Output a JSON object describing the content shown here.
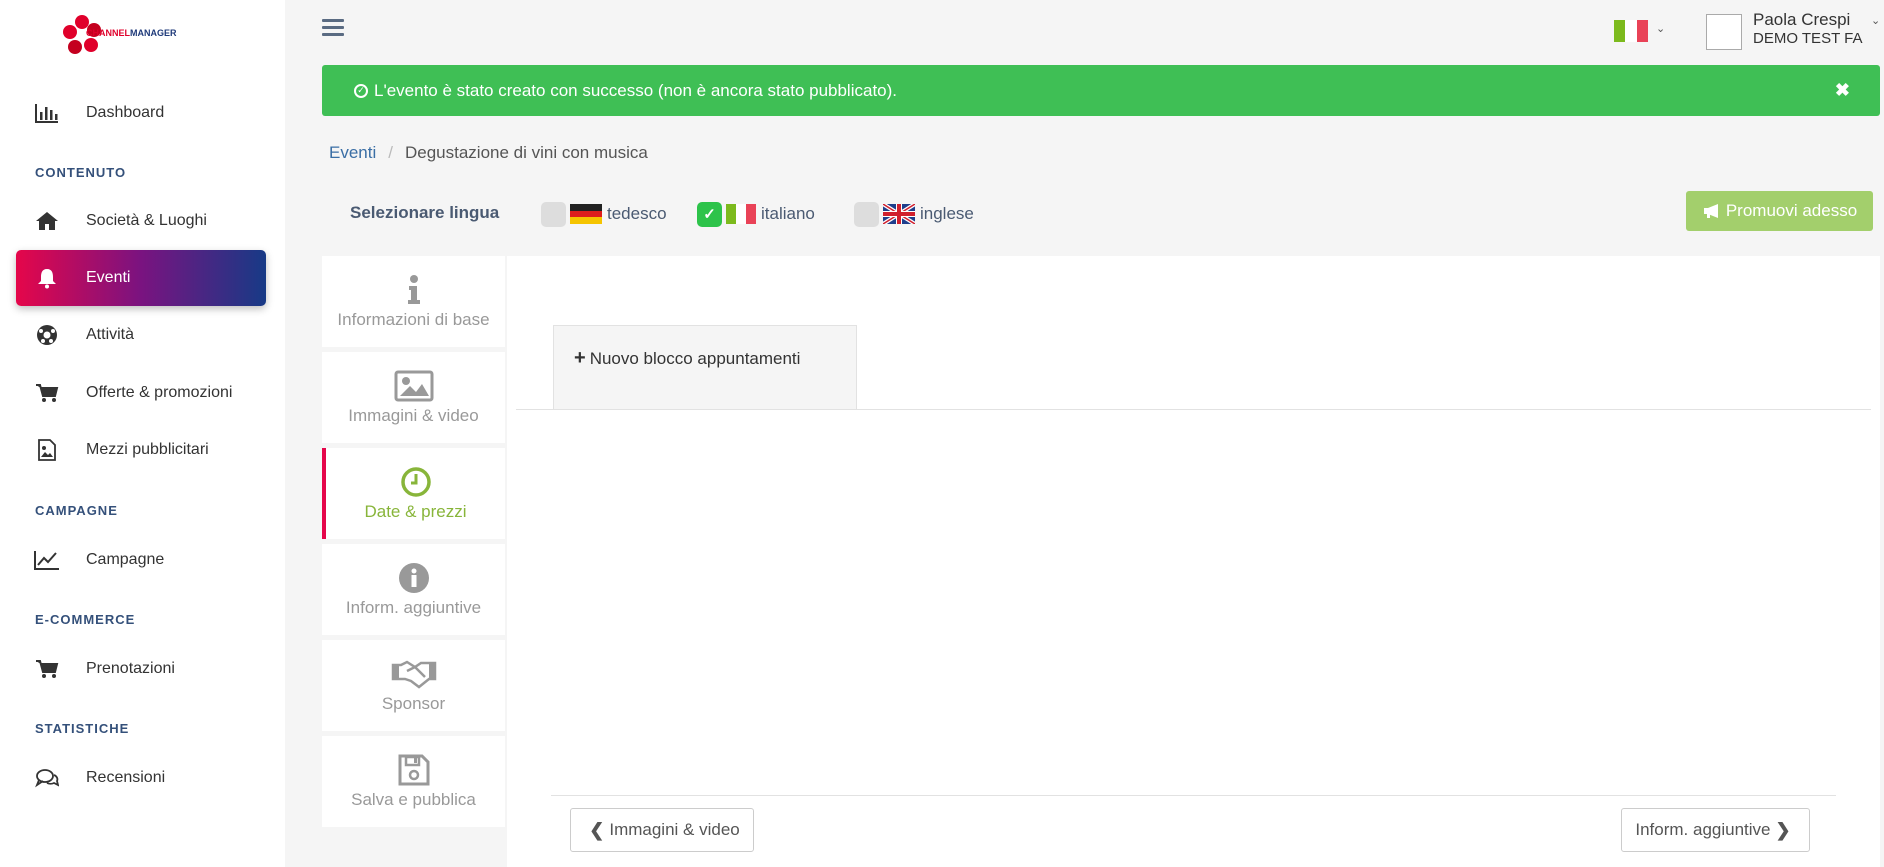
{
  "app": {
    "logo_text_part1": "CHANNEL",
    "logo_text_part2": "MANAGER"
  },
  "sidebar": {
    "items": [
      {
        "label": "Dashboard",
        "icon": "bar-chart-icon"
      },
      {
        "label": "Società & Luoghi",
        "icon": "home-icon"
      },
      {
        "label": "Eventi",
        "icon": "bell-icon"
      },
      {
        "label": "Attività",
        "icon": "soccer-ball-icon"
      },
      {
        "label": "Offerte & promozioni",
        "icon": "cart-icon"
      },
      {
        "label": "Mezzi pubblicitari",
        "icon": "image-file-icon"
      },
      {
        "label": "Campagne",
        "icon": "line-chart-icon"
      },
      {
        "label": "Prenotazioni",
        "icon": "cart-icon"
      },
      {
        "label": "Recensioni",
        "icon": "comments-icon"
      }
    ],
    "sections": {
      "contenuto": "CONTENUTO",
      "campagne": "CAMPAGNE",
      "ecommerce": "E-COMMERCE",
      "statistiche": "STATISTICHE"
    },
    "active_item": "Eventi"
  },
  "header": {
    "user_name": "Paola Crespi",
    "user_org": "DEMO TEST FA"
  },
  "alert": {
    "message": "L'evento è stato creato con successo (non è ancora stato pubblicato).",
    "color": "#3fbf55"
  },
  "breadcrumb": {
    "parent": "Eventi",
    "separator": "/",
    "current": "Degustazione di vini con musica"
  },
  "language": {
    "label": "Selezionare lingua",
    "options": [
      {
        "label": "tedesco",
        "checked": false
      },
      {
        "label": "italiano",
        "checked": true
      },
      {
        "label": "inglese",
        "checked": false
      }
    ]
  },
  "promote_button": "Promuovi adesso",
  "steps": [
    {
      "label": "Informazioni di base",
      "icon": "info-icon",
      "active": false
    },
    {
      "label": "Immagini & video",
      "icon": "picture-icon",
      "active": false
    },
    {
      "label": "Date & prezzi",
      "icon": "clock-icon",
      "active": true
    },
    {
      "label": "Inform. aggiuntive",
      "icon": "info-circle-icon",
      "active": false
    },
    {
      "label": "Sponsor",
      "icon": "handshake-icon",
      "active": false
    },
    {
      "label": "Salva e pubblica",
      "icon": "floppy-disk-icon",
      "active": false
    }
  ],
  "main": {
    "new_block_tab": "Nuovo blocco appuntamenti",
    "prev_button": "Immagini & video",
    "next_button": "Inform. aggiuntive"
  },
  "colors": {
    "accent_green": "#88b53a",
    "active_gradient_start": "#e5064a",
    "active_gradient_end": "#173a86"
  }
}
